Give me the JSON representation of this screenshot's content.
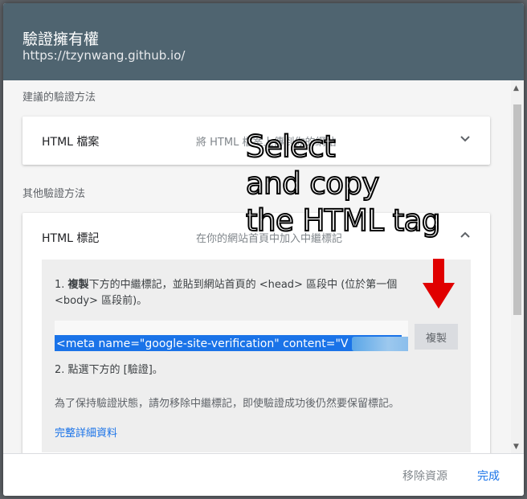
{
  "dialog": {
    "title": "驗證擁有權",
    "url": "https://tzynwang.github.io/"
  },
  "recommended": {
    "label": "建議的驗證方法",
    "method": {
      "name": "HTML 檔案",
      "desc": "將 HTML 檔案上傳到你的網站"
    }
  },
  "other": {
    "label": "其他驗證方法",
    "method": {
      "name": "HTML 標記",
      "desc": "在你的網站首頁中加入中繼標記"
    }
  },
  "instructions": {
    "step1_prefix": "1. ",
    "step1_bold": "複製",
    "step1_rest": "下方的中繼標記，並貼到網站首頁的 <head> 區段中 (位於第一個",
    "step1_line2": "<body> 區段前)。",
    "meta_tag": "<meta name=\"google-site-verification\" content=\"V",
    "copy_label": "複製",
    "step2": "2. 點選下方的 [驗證]。",
    "note": "為了保持驗證狀態，請勿移除中繼標記，即使驗證成功後仍然要保留標記。",
    "details_link": "完整詳細資料"
  },
  "footer": {
    "remove_label": "移除資源",
    "done_label": "完成"
  },
  "annotation": {
    "line1": "Select",
    "line2": "and copy",
    "line3": "the HTML tag"
  },
  "colors": {
    "header": "#4f6470",
    "accent": "#1a73e8",
    "arrow": "#e00000"
  }
}
